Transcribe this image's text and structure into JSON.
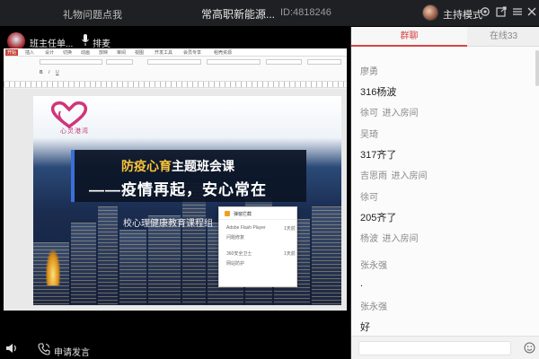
{
  "topbar": {
    "notice": "礼物问题点我",
    "room_title": "常高职新能源...",
    "room_id": "ID:4818246",
    "host_mode_label": "主持模式",
    "icons": [
      "settings-icon",
      "popout-icon",
      "menu-icon"
    ]
  },
  "video": {
    "streamer_name": "班主任单...",
    "queue_label": "排麦"
  },
  "screen": {
    "ribbon_tabs": [
      "开始",
      "插入",
      "设计",
      "切换",
      "动画",
      "放映",
      "审阅",
      "视图",
      "开发工具",
      "会员专享",
      "稻壳资源"
    ],
    "slide": {
      "logo_text": "心灵港湾",
      "title_highlight": "防疫心育",
      "title_rest": "主题班会课",
      "headline": "——疫情再起，安心常在",
      "subtitle": "校心理健康教育课程组"
    },
    "popup": {
      "title": "弹窗拦截",
      "rows": [
        {
          "name": "Adobe Flash Player",
          "sub": "问题修复",
          "time": "1天前"
        },
        {
          "name": "360安全卫士",
          "sub": "网站防护",
          "time": "1天前"
        }
      ]
    }
  },
  "bottom": {
    "request_label": "申请发言"
  },
  "chat": {
    "tabs": {
      "group": "群聊",
      "online": "在线33"
    },
    "messages": [
      {
        "user": "廖勇",
        "text": "316杨波"
      },
      {
        "user": "徐可",
        "system": "进入房间"
      },
      {
        "user": "吴琦",
        "text": "317齐了"
      },
      {
        "user": "吉思雨",
        "system": "进入房间"
      },
      {
        "user": "徐可",
        "text": "205齐了"
      },
      {
        "user": "杨波",
        "system": "进入房间"
      },
      {
        "user": "张永强",
        "text": "."
      },
      {
        "user": "张永强",
        "text": "好"
      }
    ]
  }
}
